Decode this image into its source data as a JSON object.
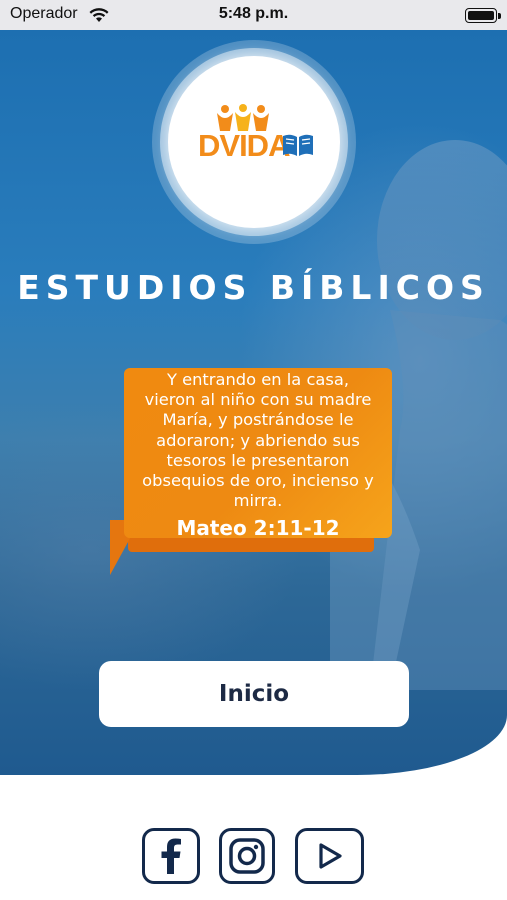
{
  "status_bar": {
    "carrier": "Operador",
    "time": "5:48 p.m."
  },
  "logo": {
    "text": "DVIDA",
    "colors": {
      "orange": "#f28c1a",
      "blue": "#1f6fb8",
      "yellow": "#f6b21b"
    }
  },
  "header": {
    "title": "ESTUDIOS BÍBLICOS"
  },
  "verse": {
    "lines": [
      "Y entrando en la casa,",
      "vieron al niño con su madre",
      "María, y postrándose le",
      "adoraron; y abriendo sus",
      "tesoros le presentaron",
      "obsequios de oro, incienso y",
      "mirra."
    ],
    "reference": "Mateo 2:11-12"
  },
  "actions": {
    "start_label": "Inicio"
  },
  "social": {
    "icons": [
      "facebook-icon",
      "instagram-icon",
      "youtube-icon"
    ],
    "color": "#13294b"
  },
  "colors": {
    "hero_blue": "#1d6fb1",
    "bubble_orange": "#f08a10",
    "button_text": "#1d2a44"
  }
}
